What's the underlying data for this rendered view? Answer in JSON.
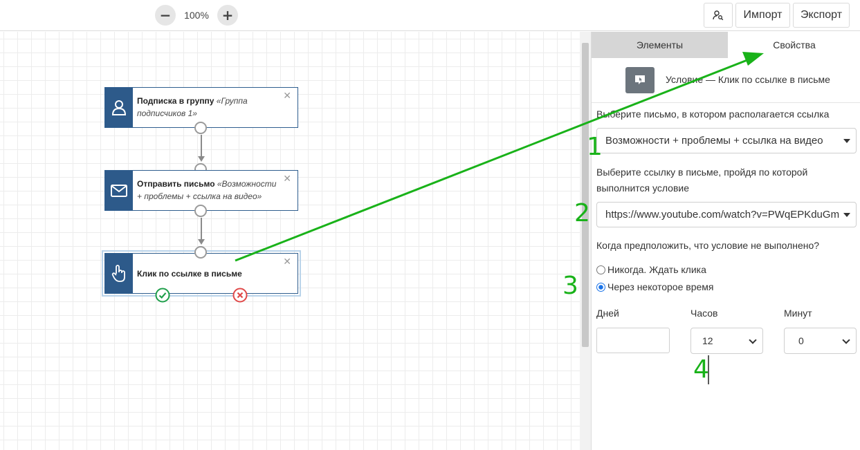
{
  "toolbar": {
    "zoom_out": "−",
    "zoom_in": "+",
    "zoom_level": "100%",
    "user_search_icon": "user-search-icon",
    "import_label": "Импорт",
    "export_label": "Экспорт"
  },
  "canvas": {
    "nodes": [
      {
        "icon": "user-icon",
        "title": "Подписка в группу",
        "detail": "«Группа подписчиков 1»",
        "close": "✕"
      },
      {
        "icon": "envelope-icon",
        "title": "Отправить письмо",
        "detail": "«Возможности + проблемы + ссылка на видео»",
        "close": "✕"
      },
      {
        "icon": "hand-pointer-icon",
        "title": "Клик по ссылке в письме",
        "detail": "",
        "close": "✕"
      }
    ],
    "outcomes": {
      "yes_icon": "check-circle-icon",
      "no_icon": "x-circle-icon"
    }
  },
  "panel": {
    "tabs": [
      "Элементы",
      "Свойства"
    ],
    "active_tab": "Свойства",
    "condition_title": "Условие — Клик по ссылке в письме",
    "email_label": "Выберите письмо, в котором располагается ссылка",
    "email_value": "Возможности + проблемы + ссылка на видео",
    "link_label": "Выберите ссылку в письме, пройдя по которой выполнится условие",
    "link_value": "https://www.youtube.com/watch?v=PWqEPKduGm",
    "fail_label": "Когда предположить, что условие не выполнено?",
    "radio_never": "Никогда. Ждать клика",
    "radio_after": "Через некоторое время",
    "selected_radio": "radio_after",
    "days_label": "Дней",
    "days_value": "",
    "hours_label": "Часов",
    "hours_value": "12",
    "minutes_label": "Минут",
    "minutes_value": "0"
  },
  "annotations": [
    "1",
    "2",
    "3",
    "4"
  ],
  "colors": {
    "node_blue": "#2d5a8a",
    "annotation_green": "#19b219",
    "success_green": "#1e9e4a",
    "danger_red": "#e04848",
    "active_tab_bg": "#ffffff",
    "inactive_tab_bg": "#d6d6d6"
  }
}
